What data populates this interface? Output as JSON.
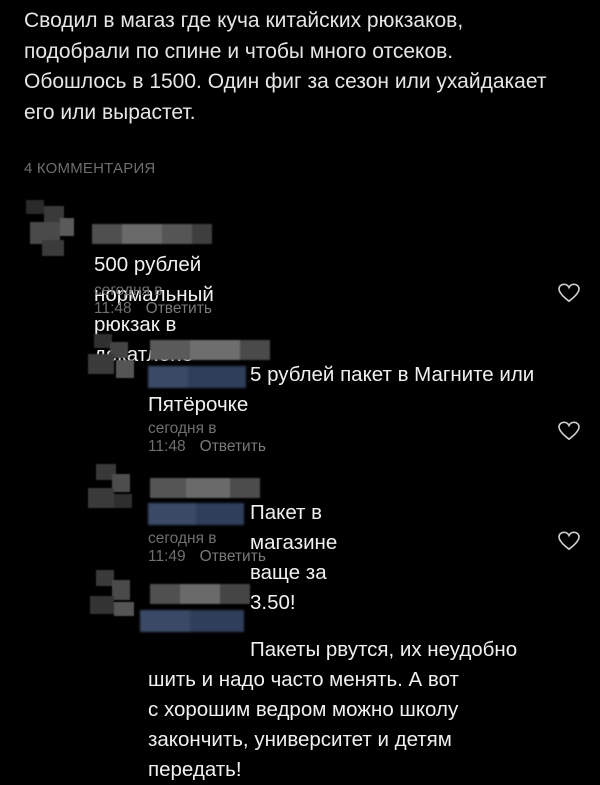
{
  "post": {
    "text": "Сводил в магаз где куча китайских рюкзаков,\nподобрали по спине и чтобы много отсеков.\nОбошлось в 1500. Один фиг за сезон или ухайдакает\nего или вырастет."
  },
  "comments_header": "4 КОММЕНТАРИЯ",
  "reply_label": "Ответить",
  "comments": [
    {
      "text": "500 рублей нормальный рюкзак в декатлоне",
      "time": "сегодня в 11:48",
      "reply": "Ответить"
    },
    {
      "text_first": "5 рублей пакет в Магните или",
      "text_rest": "Пятёрочке",
      "time": "сегодня в 11:48",
      "reply": "Ответить"
    },
    {
      "text_first": "Пакет в магазине ваще за 3.50!",
      "time": "сегодня в 11:49",
      "reply": "Ответить"
    },
    {
      "text_first": "Пакеты рвутся, их неудобно",
      "text_rest": "шить и надо часто менять. А вот\nс хорошим ведром можно школу\nзакончить, университет и детям\nпередать!"
    }
  ],
  "colors": {
    "background": "#000000",
    "text": "#f0f0f0",
    "muted": "#6f6f6f",
    "reply_mention_blur": "#3a4a66"
  },
  "icons": [
    "heart-icon"
  ]
}
